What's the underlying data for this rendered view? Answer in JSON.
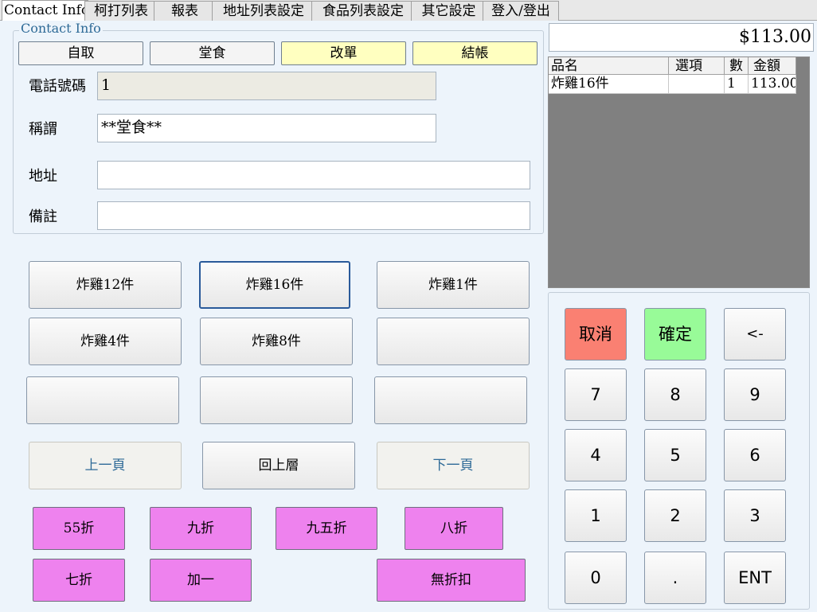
{
  "tabs": [
    {
      "label": "Contact Info",
      "active": true
    },
    {
      "label": "柯打列表"
    },
    {
      "label": "報表"
    },
    {
      "label": "地址列表設定"
    },
    {
      "label": "食品列表設定"
    },
    {
      "label": "其它設定"
    },
    {
      "label": "登入/登出"
    }
  ],
  "contact": {
    "legend": "Contact Info",
    "buttons": [
      "自取",
      "堂食",
      "改單",
      "結帳"
    ],
    "phone_label": "電話號碼",
    "phone_value": "1",
    "name_label": "稱謂",
    "name_value": "**堂食**",
    "address_label": "地址",
    "address_value": "",
    "notes_label": "備註",
    "notes_value": ""
  },
  "food_items": [
    "炸雞12件",
    "炸雞16件",
    "炸雞1件",
    "炸雞4件",
    "炸雞8件",
    "",
    "",
    "",
    ""
  ],
  "nav": {
    "prev": "上一頁",
    "back": "回上層",
    "next": "下一頁"
  },
  "discounts": [
    "55折",
    "九折",
    "九五折",
    "八折",
    "七折",
    "加一",
    "無折扣"
  ],
  "order": {
    "total": "$113.00",
    "columns": [
      "品名",
      "選項",
      "數",
      "金額"
    ],
    "rows": [
      {
        "name": "炸雞16件",
        "option": "",
        "qty": "1",
        "amount": "113.00"
      }
    ]
  },
  "keypad": {
    "cancel": "取消",
    "confirm": "確定",
    "backspace": "<-",
    "digits": [
      "7",
      "8",
      "9",
      "4",
      "5",
      "6",
      "1",
      "2",
      "3",
      "0",
      "."
    ],
    "enter": "ENT"
  },
  "colors": {
    "highlight_button": "#ffffc0",
    "discount_button": "#ee82ee",
    "cancel_key": "#fa8072",
    "confirm_key": "#98fb98",
    "accent_text": "#2e6a97"
  }
}
